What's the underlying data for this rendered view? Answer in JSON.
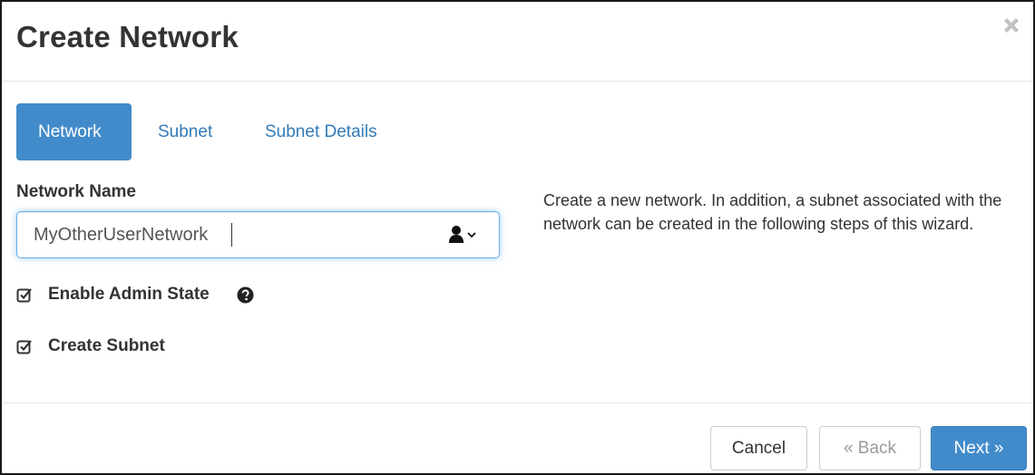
{
  "dialog": {
    "title": "Create Network",
    "close_icon": "close-icon"
  },
  "tabs": [
    {
      "label": "Network",
      "active": true
    },
    {
      "label": "Subnet",
      "active": false
    },
    {
      "label": "Subnet Details",
      "active": false
    }
  ],
  "form": {
    "network_name_label": "Network Name",
    "network_name_value": "MyOtherUserNetwork",
    "user_picker_icon": "user-icon",
    "enable_admin_state": {
      "label": "Enable Admin State",
      "checked": true,
      "help_icon": "question-circle-icon"
    },
    "create_subnet": {
      "label": "Create Subnet",
      "checked": true
    }
  },
  "help_text": "Create a new network. In addition, a subnet associated with the network can be created in the following steps of this wizard.",
  "footer": {
    "cancel_label": "Cancel",
    "back_label": "« Back",
    "next_label": "Next »"
  },
  "colors": {
    "primary": "#428bca",
    "link": "#337ab7",
    "text": "#333333",
    "focus_border": "#66afe9"
  }
}
